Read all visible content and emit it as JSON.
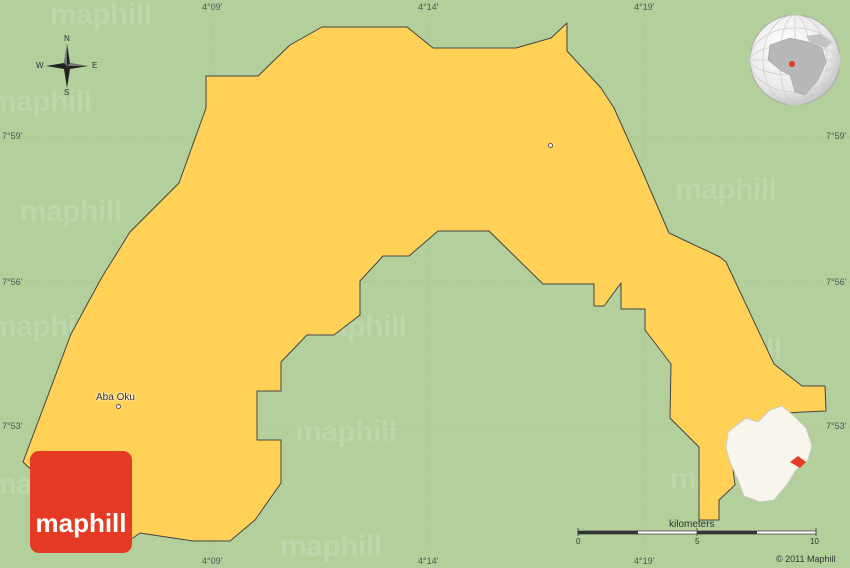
{
  "map": {
    "colors": {
      "background": "#b2cf9c",
      "region_fill": "#ffd257",
      "region_stroke": "#444444",
      "brand": "#e53a24"
    },
    "top_coords": [
      "4°09'",
      "4°14'",
      "4°19'"
    ],
    "bottom_coords": [
      "4°09'",
      "4°14'",
      "4°19'"
    ],
    "left_coords": [
      "7°59'",
      "7°56'",
      "7°53'"
    ],
    "right_coords": [
      "7°59'",
      "7°56'",
      "7°53'"
    ],
    "watermark": "maphill",
    "compass": {
      "n": "N",
      "s": "S",
      "e": "E",
      "w": "W",
      "icon": "compass-rose-icon"
    },
    "places": [
      {
        "name": "Aba Oku"
      },
      {
        "name": ""
      }
    ],
    "logo": {
      "text": "maphill",
      "icon": "maphill-logo-icon"
    },
    "scale": {
      "title": "kilometers",
      "ticks": [
        "0",
        "5",
        "10"
      ]
    },
    "copyright": "© 2011 Maphill",
    "globe_icon": "globe-locator-icon",
    "inset_icon": "region-locator-icon"
  }
}
